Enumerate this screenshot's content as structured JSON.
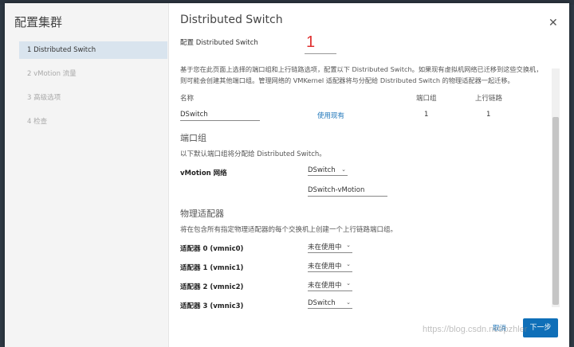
{
  "dialog": {
    "title": "配置集群"
  },
  "steps": [
    {
      "label": "1  Distributed Switch",
      "active": true
    },
    {
      "label": "2  vMotion 流量",
      "active": false
    },
    {
      "label": "3  高级选项",
      "active": false
    },
    {
      "label": "4  检查",
      "active": false
    }
  ],
  "main": {
    "title": "Distributed Switch",
    "subtitle": "配置 Distributed Switch",
    "annotation": "1",
    "description": "基于您在此页面上选择的端口组和上行链路选项，配置以下 Distributed Switch。如果现有虚拟机网络已迁移到这些交换机，则可能会创建其他端口组。管理网络的 VMKernel 适配器将与分配给 Distributed Switch 的物理适配器一起迁移。",
    "table": {
      "headers": {
        "name": "名称",
        "portgroup": "端口组",
        "uplink": "上行链路"
      },
      "row": {
        "name": "DSwitch",
        "use_existing": "使用现有",
        "portgroup": "1",
        "uplink": "1"
      }
    },
    "portgroup_section": {
      "title": "端口组",
      "desc": "以下默认端口组将分配给 Distributed Switch。",
      "vmotion_label": "vMotion 网络",
      "vmotion_switch": "DSwitch",
      "vmotion_pg": "DSwitch-vMotion"
    },
    "adapter_section": {
      "title": "物理适配器",
      "desc": "将在包含所有指定物理适配器的每个交换机上创建一个上行链路端口组。",
      "adapters": [
        {
          "label": "适配器 0 (vmnic0)",
          "value": "未在使用中"
        },
        {
          "label": "适配器 1 (vmnic1)",
          "value": "未在使用中"
        },
        {
          "label": "适配器 2 (vmnic2)",
          "value": "未在使用中"
        },
        {
          "label": "适配器 3 (vmnic3)",
          "value": "DSwitch"
        }
      ]
    }
  },
  "footer": {
    "cancel": "取消",
    "next": "下一步"
  },
  "watermark": "https://blog.csdn.net/pzhler",
  "icons": {
    "close": "close-icon",
    "chevron": "chevron-down-icon"
  },
  "colors": {
    "accent": "#0f6fb8",
    "link": "#1a73b8",
    "active_step": "#d9e4ee",
    "annotation": "#e03030"
  }
}
